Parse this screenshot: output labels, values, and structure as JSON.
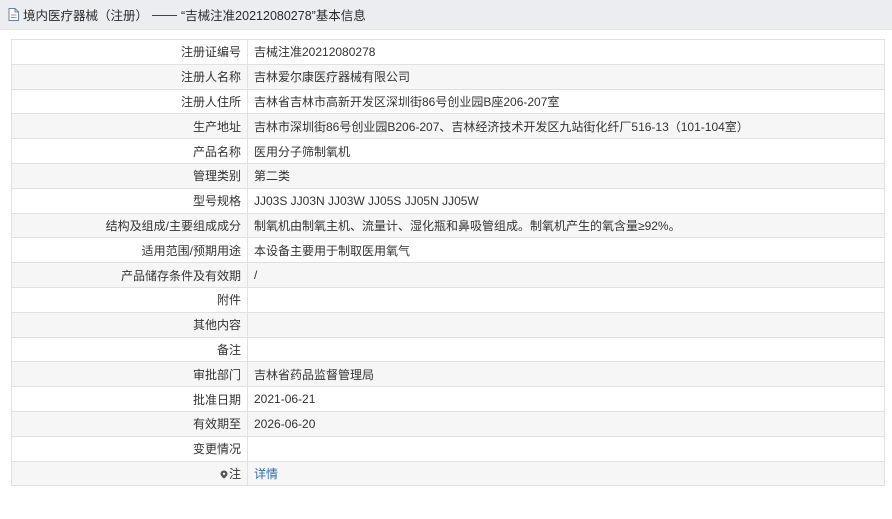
{
  "header": {
    "section": "境内医疗器械（注册）",
    "separator": "——",
    "title": "“吉械注准20212080278”基本信息"
  },
  "rows": [
    {
      "label": "注册证编号",
      "value": "吉械注准20212080278"
    },
    {
      "label": "注册人名称",
      "value": "吉林爱尔康医疗器械有限公司"
    },
    {
      "label": "注册人住所",
      "value": "吉林省吉林市高新开发区深圳街86号创业园B座206-207室"
    },
    {
      "label": "生产地址",
      "value": "吉林市深圳街86号创业园B206-207、吉林经济技术开发区九站街化纤厂516-13（101-104室）"
    },
    {
      "label": "产品名称",
      "value": "医用分子筛制氧机"
    },
    {
      "label": "管理类别",
      "value": "第二类"
    },
    {
      "label": "型号规格",
      "value": "JJ03S JJ03N JJ03W JJ05S JJ05N JJ05W"
    },
    {
      "label": "结构及组成/主要组成成分",
      "value": "制氧机由制氧主机、流量计、湿化瓶和鼻吸管组成。制氧机产生的氧含量≥92%。"
    },
    {
      "label": "适用范围/预期用途",
      "value": "本设备主要用于制取医用氧气"
    },
    {
      "label": "产品储存条件及有效期",
      "value": "/"
    },
    {
      "label": "附件",
      "value": ""
    },
    {
      "label": "其他内容",
      "value": ""
    },
    {
      "label": "备注",
      "value": ""
    },
    {
      "label": "审批部门",
      "value": "吉林省药品监督管理局"
    },
    {
      "label": "批准日期",
      "value": "2021-06-21"
    },
    {
      "label": "有效期至",
      "value": "2026-06-20"
    },
    {
      "label": "变更情况",
      "value": ""
    }
  ],
  "note": {
    "label": "注",
    "link": "详情",
    "icon": "note-marker-icon"
  },
  "colors": {
    "header_bg": "#ecedf0",
    "link": "#2f6db5",
    "row_alt": "#f6f6f6",
    "border": "#e1e1e1"
  }
}
